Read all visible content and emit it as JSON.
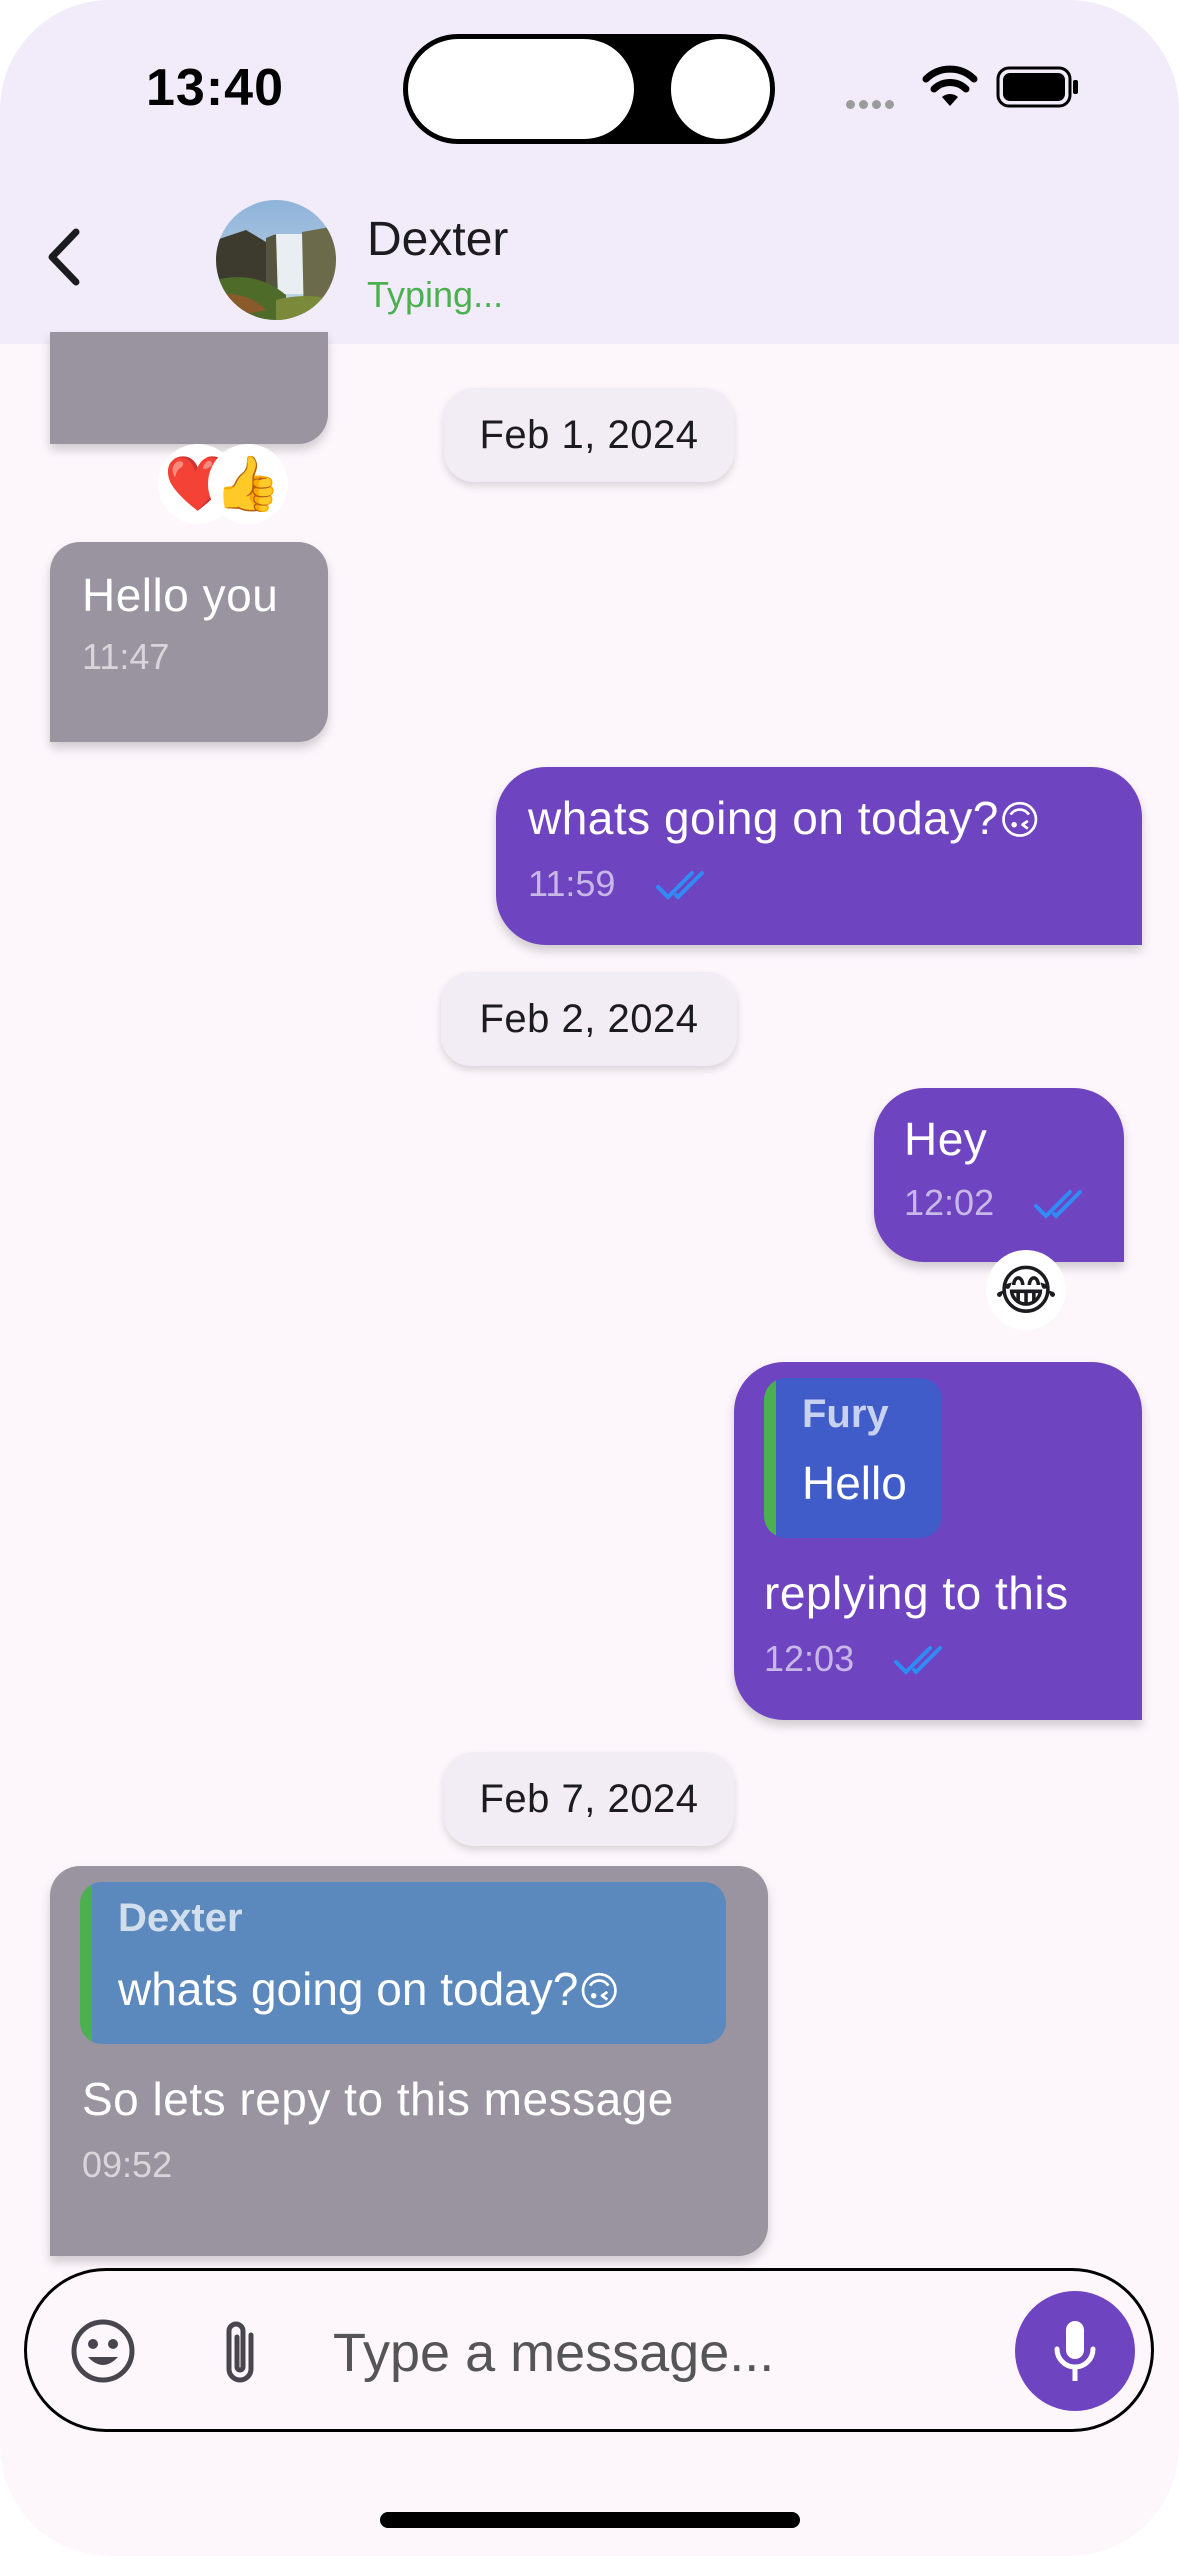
{
  "status_bar": {
    "time": "13:40"
  },
  "header": {
    "contact_name": "Dexter",
    "contact_status": "Typing..."
  },
  "messages": {
    "partial_reactions": [
      "❤️",
      "👍"
    ],
    "date1": "Feb 1, 2024",
    "m1": {
      "text": "Hello you",
      "time": "11:47"
    },
    "m2": {
      "text": "whats going on today?",
      "emoji": "🙃",
      "time": "11:59"
    },
    "date2": "Feb 2, 2024",
    "m3": {
      "text": "Hey",
      "time": "12:02",
      "reaction": "😂"
    },
    "m4": {
      "reply_to_name": "Fury",
      "reply_to_text": "Hello",
      "text": "replying to this",
      "time": "12:03"
    },
    "date3": "Feb 7, 2024",
    "m5": {
      "reply_to_name": "Dexter",
      "reply_to_text": "whats going on today?",
      "reply_to_emoji": "🙃",
      "text": "So lets repy to this message",
      "time": "09:52"
    }
  },
  "composer": {
    "placeholder": "Type a message..."
  },
  "colors": {
    "outgoing": "#6f44c0",
    "incoming": "#99949f",
    "typing": "#4caf50",
    "read_check": "#2f8cf5",
    "reply_outgoing": "#3f5cc9",
    "reply_incoming": "#5b88bd"
  }
}
